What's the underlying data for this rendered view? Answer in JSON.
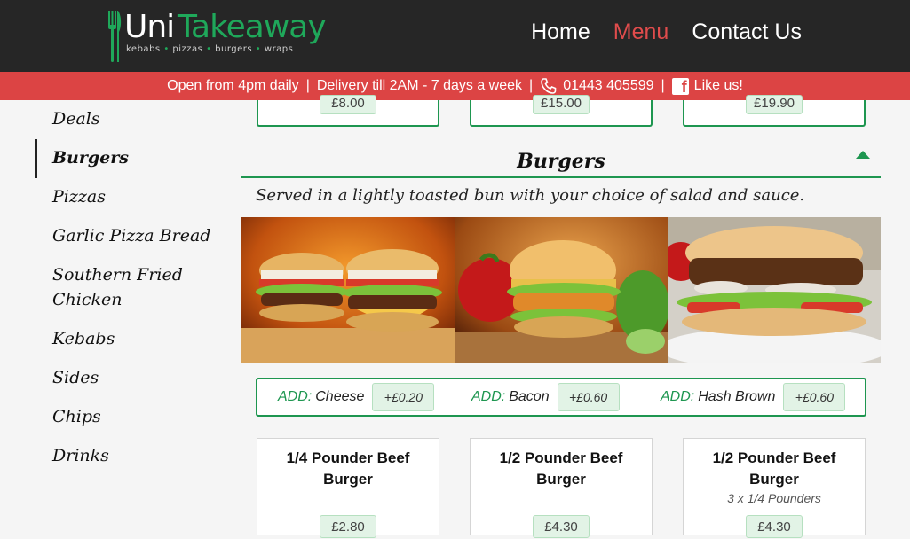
{
  "brand": {
    "name_part1": "Uni",
    "name_part2": "Takeaway",
    "tagline": [
      "kebabs",
      "pizzas",
      "burgers",
      "wraps"
    ]
  },
  "nav": {
    "home": "Home",
    "menu": "Menu",
    "contact": "Contact Us",
    "active": "Menu"
  },
  "infobar": {
    "hours": "Open from 4pm daily",
    "delivery": "Delivery till 2AM - 7 days a week",
    "phone": "01443 405599",
    "facebook": "Like us!",
    "separator": "|"
  },
  "sidebar": {
    "items": [
      {
        "label": "Deals"
      },
      {
        "label": "Burgers"
      },
      {
        "label": "Pizzas"
      },
      {
        "label": "Garlic Pizza Bread"
      },
      {
        "label": "Southern Fried Chicken"
      },
      {
        "label": "Kebabs"
      },
      {
        "label": "Sides"
      },
      {
        "label": "Chips"
      },
      {
        "label": "Drinks"
      }
    ],
    "active": "Burgers"
  },
  "previous_cards": [
    {
      "price": "£8.00"
    },
    {
      "price": "£15.00"
    },
    {
      "price": "£19.90"
    }
  ],
  "section": {
    "title": "Burgers",
    "description": "Served in a lightly toasted bun with your choice of salad and sauce."
  },
  "addons": [
    {
      "prefix": "ADD:",
      "name": "Cheese",
      "price": "+£0.20"
    },
    {
      "prefix": "ADD:",
      "name": "Bacon",
      "price": "+£0.60"
    },
    {
      "prefix": "ADD:",
      "name": "Hash Brown",
      "price": "+£0.60"
    }
  ],
  "products": [
    {
      "name": "1/4 Pounder Beef Burger",
      "note": "",
      "price": "£2.80"
    },
    {
      "name": "1/2 Pounder Beef Burger",
      "note": "",
      "price": "£4.30"
    },
    {
      "name": "1/2 Pounder Beef Burger",
      "note": "3 x 1/4 Pounders",
      "price": "£4.30"
    }
  ],
  "colors": {
    "header_bg": "#262626",
    "accent_red": "#dc4444",
    "accent_green": "#1e9650",
    "price_bg": "#e2f3e6"
  }
}
